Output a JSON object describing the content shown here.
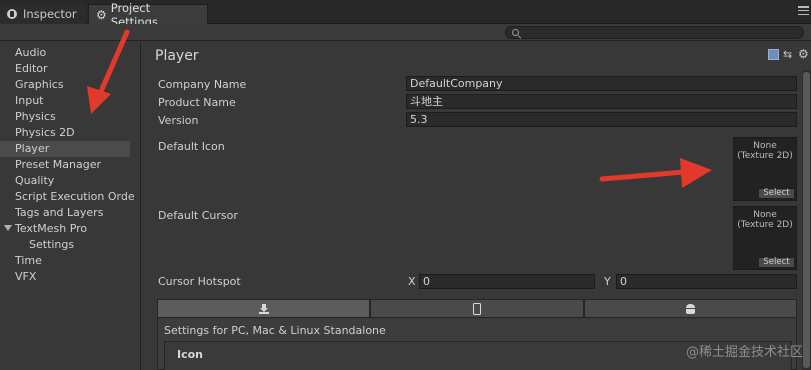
{
  "tabs": [
    {
      "label": "Inspector",
      "icon": "info-icon"
    },
    {
      "label": "Project Settings",
      "icon": "gear-icon"
    }
  ],
  "sidebar": {
    "items": [
      {
        "label": "Audio"
      },
      {
        "label": "Editor"
      },
      {
        "label": "Graphics"
      },
      {
        "label": "Input"
      },
      {
        "label": "Physics"
      },
      {
        "label": "Physics 2D"
      },
      {
        "label": "Player",
        "selected": true
      },
      {
        "label": "Preset Manager"
      },
      {
        "label": "Quality"
      },
      {
        "label": "Script Execution Orde"
      },
      {
        "label": "Tags and Layers"
      },
      {
        "label": "TextMesh Pro",
        "expanded": true
      },
      {
        "label": "Settings",
        "child": true
      },
      {
        "label": "Time"
      },
      {
        "label": "VFX"
      }
    ]
  },
  "main": {
    "title": "Player",
    "fields": {
      "company_label": "Company Name",
      "company_value": "DefaultCompany",
      "product_label": "Product Name",
      "product_value": "斗地主",
      "version_label": "Version",
      "version_value": "5.3",
      "default_icon_label": "Default Icon",
      "default_cursor_label": "Default Cursor",
      "cursor_hotspot_label": "Cursor Hotspot",
      "hotspot_x_label": "X",
      "hotspot_x_value": "0",
      "hotspot_y_label": "Y",
      "hotspot_y_value": "0"
    },
    "texture_slot": {
      "line1": "None",
      "line2": "(Texture 2D)",
      "select": "Select"
    },
    "platform_tabs": [
      {
        "icon": "download-icon",
        "active": true
      },
      {
        "icon": "phone-icon"
      },
      {
        "icon": "android-icon"
      }
    ],
    "settings_title": "Settings for PC, Mac & Linux Standalone",
    "icon_section": "Icon"
  },
  "watermark": "@稀土掘金技术社区",
  "colors": {
    "background": "#383838",
    "field": "#2a2a2a",
    "annotation_arrow": "#e23a2a"
  }
}
